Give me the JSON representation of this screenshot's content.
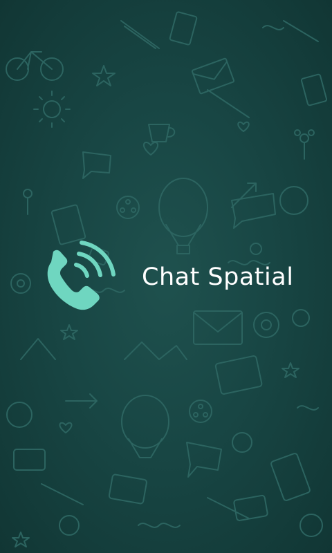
{
  "app": {
    "name": "Chat Spatial",
    "logo_icon": "phone-signal-icon",
    "logo_color": "#6fd6c0"
  },
  "background": {
    "color": "#163f3d",
    "pattern": "doodle-pattern"
  }
}
